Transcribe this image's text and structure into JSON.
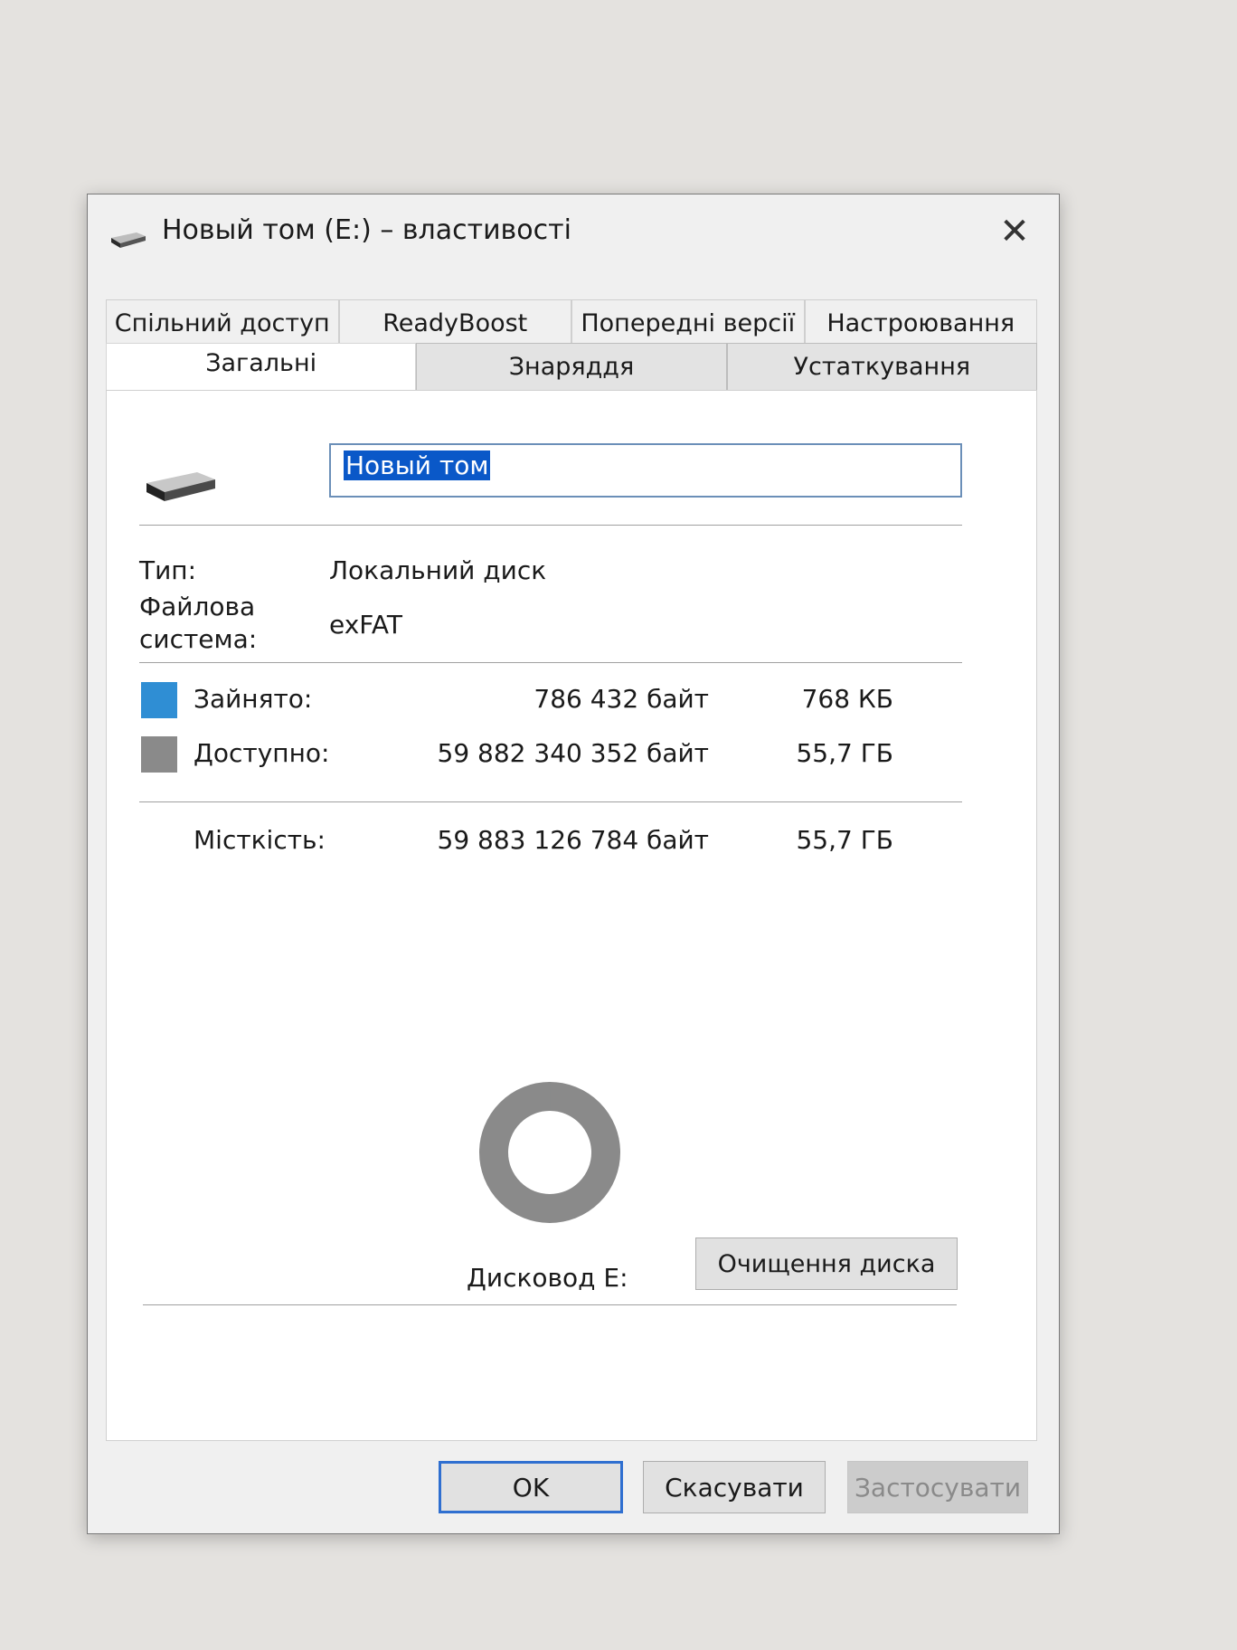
{
  "window": {
    "title": "Новый том (E:) – властивості",
    "close_glyph": "✕"
  },
  "tabs_back": [
    "Спільний доступ",
    "ReadyBoost",
    "Попередні версії",
    "Настроювання"
  ],
  "tabs_front": [
    {
      "label": "Загальні",
      "active": true
    },
    {
      "label": "Знаряддя",
      "active": false
    },
    {
      "label": "Устаткування",
      "active": false
    }
  ],
  "general": {
    "volume_name": "Новый том",
    "type_label": "Тип:",
    "type_value": "Локальний диск",
    "fs_label_line1": "Файлова",
    "fs_label_line2": "система:",
    "fs_value": "exFAT",
    "used_label": "Зайнято:",
    "used_bytes": "786 432 байт",
    "used_short": "768 КБ",
    "free_label": "Доступно:",
    "free_bytes": "59 882 340 352 байт",
    "free_short": "55,7 ГБ",
    "capacity_label": "Місткість:",
    "capacity_bytes": "59 883 126 784 байт",
    "capacity_short": "55,7 ГБ",
    "drive_label": "Дисковод E:",
    "cleanup_button": "Очищення диска",
    "used_fraction": 1.31e-05,
    "used_color": "#2f8ed4",
    "free_color": "#8a8a8a"
  },
  "icons": {
    "title": "drive-icon",
    "volume": "drive-icon"
  },
  "footer": {
    "ok": "OK",
    "cancel": "Скасувати",
    "apply": "Застосувати"
  }
}
